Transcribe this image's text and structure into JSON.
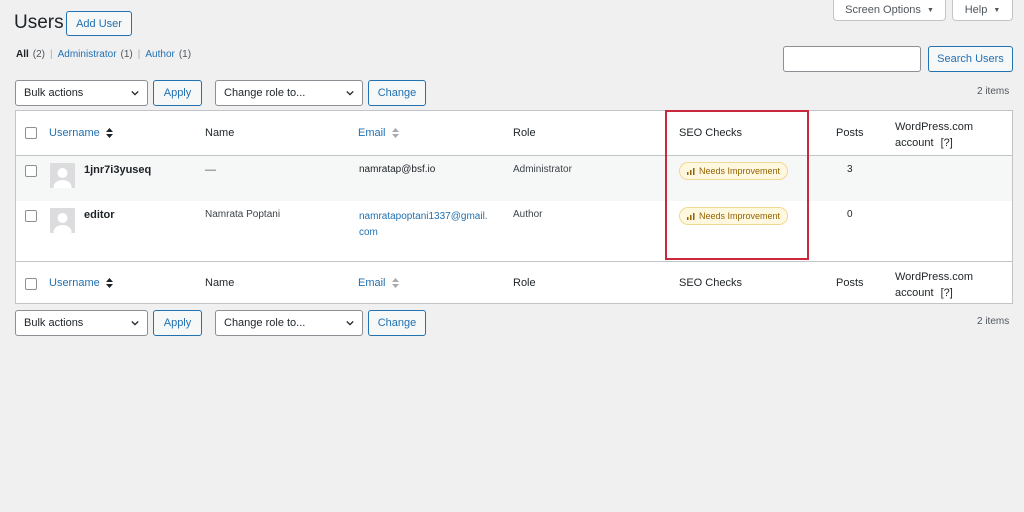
{
  "header": {
    "title": "Users",
    "add_user": "Add User",
    "screen_options": "Screen Options",
    "help": "Help"
  },
  "filters": {
    "all_label": "All",
    "all_count": "(2)",
    "administrator_label": "Administrator",
    "administrator_count": "(1)",
    "author_label": "Author",
    "author_count": "(1)",
    "separator": "|"
  },
  "search": {
    "button": "Search Users",
    "value": ""
  },
  "tablenav": {
    "bulk_actions": "Bulk actions",
    "apply": "Apply",
    "change_role": "Change role to...",
    "change": "Change",
    "items_count": "2 items"
  },
  "columns": {
    "username": "Username",
    "name": "Name",
    "email": "Email",
    "role": "Role",
    "seo_checks": "SEO Checks",
    "posts": "Posts",
    "wpcom_line1": "WordPress.com",
    "wpcom_line2": "account",
    "wpcom_help": "[?]"
  },
  "users": [
    {
      "username": "1jnr7i3yuseq",
      "name": "—",
      "email": "namratap@bsf.io",
      "email_line2": "",
      "role": "Administrator",
      "seo": "Needs Improvement",
      "posts": "3"
    },
    {
      "username": "editor",
      "name": "Namrata Poptani",
      "email": "namratapoptani1337@gmail.",
      "email_line2": "com",
      "role": "Author",
      "seo": "Needs Improvement",
      "posts": "0"
    }
  ],
  "colors": {
    "link": "#2271b1",
    "badge_text": "#946200",
    "badge_bg": "#fff8e1",
    "highlight": "#c9283e"
  }
}
